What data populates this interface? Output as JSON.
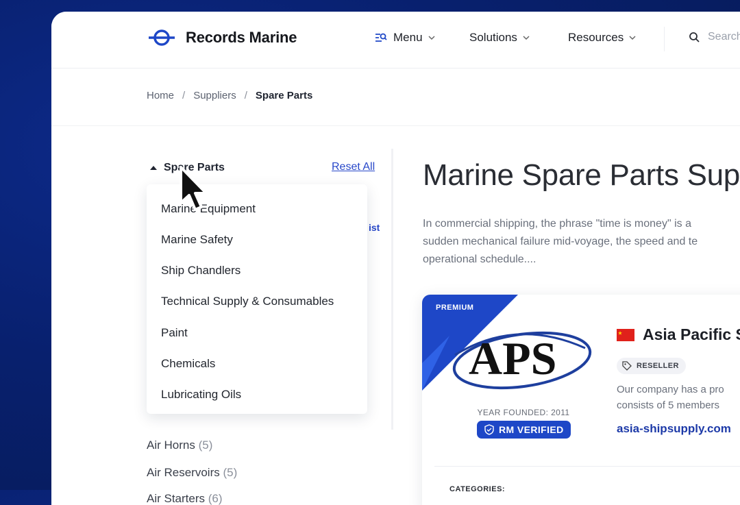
{
  "brand": {
    "name": "Records Marine"
  },
  "nav": {
    "menu": "Menu",
    "solutions": "Solutions",
    "resources": "Resources",
    "search_placeholder": "Search"
  },
  "breadcrumb": [
    "Home",
    "Suppliers",
    "Spare Parts"
  ],
  "sidebar": {
    "filter_title": "Spare Parts",
    "reset_label": "Reset All",
    "dropdown_items": [
      "Marine Equipment",
      "Marine Safety",
      "Ship Chandlers",
      "Technical Supply & Consumables",
      "Paint",
      "Chemicals",
      "Lubricating Oils"
    ],
    "categories": [
      {
        "label": "Air Horns",
        "count": "(5)"
      },
      {
        "label": "Air Reservoirs",
        "count": "(5)"
      },
      {
        "label": "Air Starters",
        "count": "(6)"
      }
    ],
    "partial_behind_text": "ist"
  },
  "main": {
    "title": "Marine Spare Parts Sup",
    "intro_lines": [
      "In commercial shipping, the phrase \"time is money\" is a",
      "sudden mechanical failure mid-voyage, the speed and te",
      "operational schedule...."
    ]
  },
  "card": {
    "badge": "PREMIUM",
    "logo_text": "APS",
    "year_founded": "YEAR FOUNDED: 2011",
    "verified_label": "RM VERIFIED",
    "company_name": "Asia Pacific S",
    "tag": "RESELLER",
    "description_lines": [
      "Our company has a pro",
      "consists of 5 members"
    ],
    "website": "asia-shipsupply.com",
    "categories_label": "CATEGORIES:"
  },
  "colors": {
    "accent": "#1e47c7",
    "link": "#2747c9",
    "background_dark": "#08206e"
  }
}
